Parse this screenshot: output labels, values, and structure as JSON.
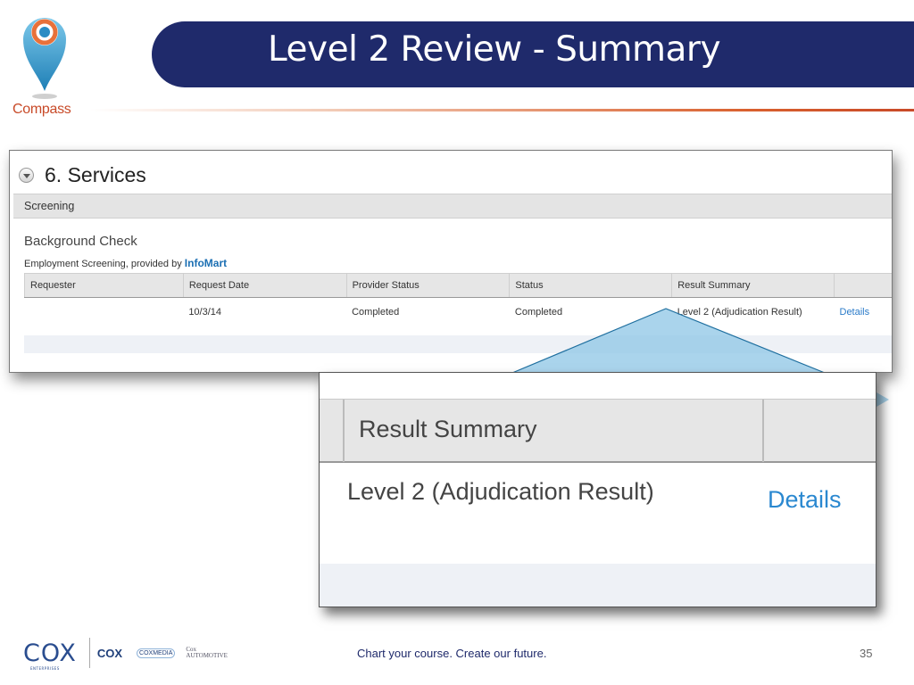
{
  "slide": {
    "logo_text": "Compass",
    "title": "Level 2 Review - Summary",
    "tagline": "Chart your course. Create our future.",
    "page_number": "35"
  },
  "services_panel": {
    "section_title": "6. Services",
    "group_label": "Screening",
    "subsection_title": "Background Check",
    "provider_line_prefix": "Employment Screening, provided by",
    "provider_name": "InfoMart",
    "columns": [
      "Requester",
      "Request Date",
      "Provider Status",
      "Status",
      "Result Summary",
      ""
    ],
    "rows": [
      {
        "requester": "",
        "request_date": "10/3/14",
        "provider_status": "Completed",
        "status": "Completed",
        "result_summary": "Level 2 (Adjudication Result)",
        "action": "Details"
      }
    ]
  },
  "zoom_panel": {
    "header": "Result Summary",
    "result": "Level 2 (Adjudication Result)",
    "action": "Details"
  },
  "footer_logos": {
    "cox_enterprises": "COX",
    "cox_enterprises_sub": "ENTERPRISES",
    "cox": "COX",
    "cox_media": "COXMEDIA",
    "cox_automotive_1": "Cox",
    "cox_automotive_2": "AUTOMOTIVE"
  },
  "colors": {
    "title_bar": "#1f2a6b",
    "accent": "#c84a28",
    "link": "#2a7bc9",
    "callout_fill": "#8ec5e6"
  },
  "icons": [
    "location-pin-icon",
    "chevron-down-icon"
  ]
}
